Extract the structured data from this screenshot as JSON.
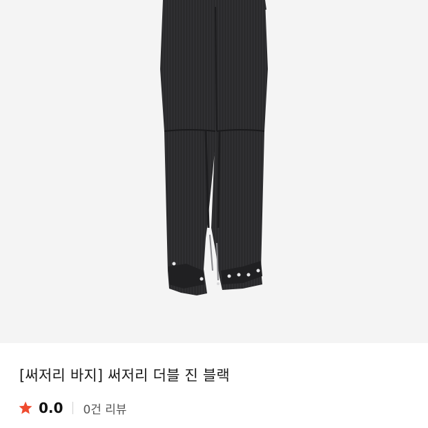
{
  "product": {
    "name": "[써저리 바지] 써저리 더블 진 블랙",
    "image_alt": "써저리 더블 진 블랙"
  },
  "rating": {
    "value": "0.0",
    "star_icon": "star-icon",
    "star_color": "#ef4b2f"
  },
  "reviews": {
    "count_label": "0건 리뷰"
  }
}
